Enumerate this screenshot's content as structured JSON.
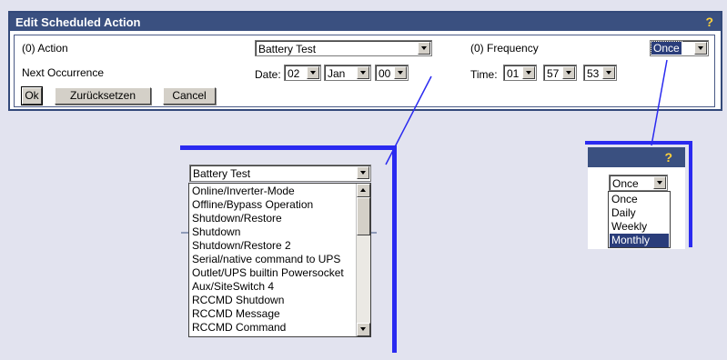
{
  "dialog": {
    "title": "Edit Scheduled Action",
    "help": "?",
    "action_label": "(0) Action",
    "action_value": "Battery Test",
    "frequency_label": "(0) Frequency",
    "frequency_value": "Once",
    "next_occurrence_label": "Next Occurrence",
    "date_label": "Date:",
    "date_day": "02",
    "date_month": "Jan",
    "date_year": "00",
    "time_label": "Time:",
    "time_hour": "01",
    "time_minute": "57",
    "time_second": "53",
    "ok_button": "Ok",
    "reset_button": "Zurücksetzen",
    "cancel_button": "Cancel"
  },
  "action_dropdown": {
    "selected": "Battery Test",
    "options": [
      "Online/Inverter-Mode",
      "Offline/Bypass Operation",
      "Shutdown/Restore",
      "Shutdown",
      "Shutdown/Restore 2",
      "Serial/native command to UPS",
      "Outlet/UPS builtin Powersocket",
      "Aux/SiteSwitch 4",
      "RCCMD Shutdown",
      "RCCMD Message",
      "RCCMD Command"
    ]
  },
  "frequency_dropdown": {
    "help": "?",
    "selected": "Once",
    "options": [
      "Once",
      "Daily",
      "Weekly",
      "Monthly"
    ],
    "highlighted": "Monthly"
  },
  "colors": {
    "titlebar": "#3a5080",
    "accent_line": "#2a2af0",
    "selection": "#2a3d7a",
    "help_icon": "#ffd23a"
  }
}
